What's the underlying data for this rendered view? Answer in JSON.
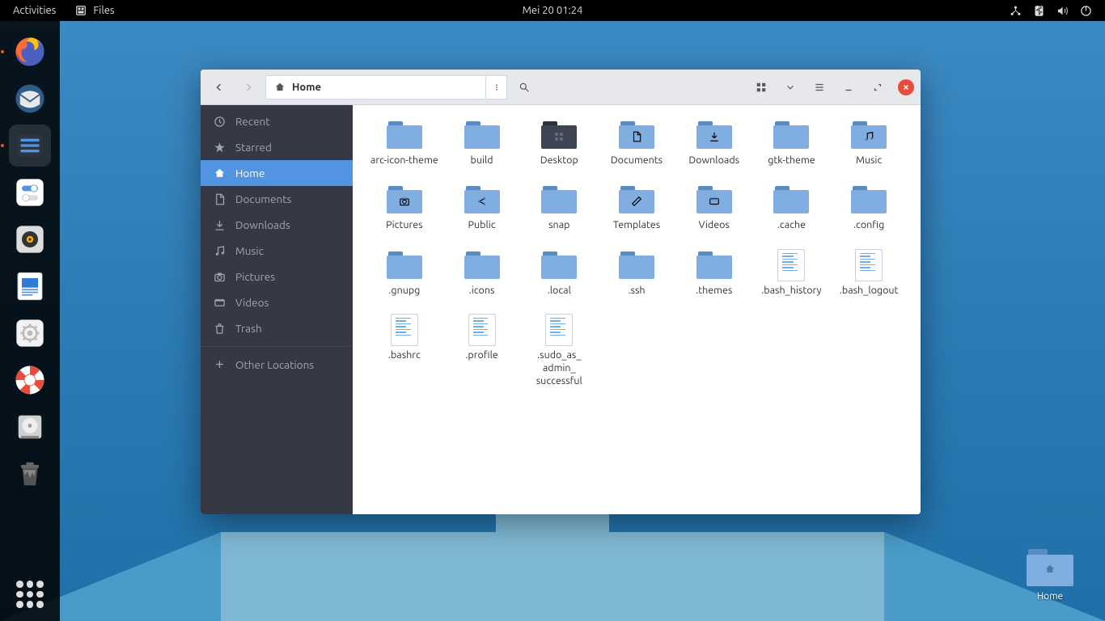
{
  "topbar": {
    "activities": "Activities",
    "app_name": "Files",
    "datetime": "Mei 20  01:24"
  },
  "desktop": {
    "home_label": "Home"
  },
  "window": {
    "path_label": "Home"
  },
  "sidebar": {
    "items": [
      {
        "id": "recent",
        "label": "Recent",
        "icon": "clock"
      },
      {
        "id": "starred",
        "label": "Starred",
        "icon": "star"
      },
      {
        "id": "home",
        "label": "Home",
        "icon": "home",
        "active": true
      },
      {
        "id": "documents",
        "label": "Documents",
        "icon": "doc"
      },
      {
        "id": "downloads",
        "label": "Downloads",
        "icon": "download"
      },
      {
        "id": "music",
        "label": "Music",
        "icon": "music"
      },
      {
        "id": "pictures",
        "label": "Pictures",
        "icon": "camera"
      },
      {
        "id": "videos",
        "label": "Videos",
        "icon": "video"
      },
      {
        "id": "trash",
        "label": "Trash",
        "icon": "trash"
      },
      {
        "id": "other",
        "label": "Other Locations",
        "icon": "plus",
        "sep": true
      }
    ]
  },
  "files": [
    {
      "name": "arc-icon-theme",
      "type": "folder"
    },
    {
      "name": "build",
      "type": "folder"
    },
    {
      "name": "Desktop",
      "type": "folder-dark",
      "inner": "grid"
    },
    {
      "name": "Documents",
      "type": "folder",
      "inner": "doc"
    },
    {
      "name": "Downloads",
      "type": "folder",
      "inner": "download"
    },
    {
      "name": "gtk-theme",
      "type": "folder"
    },
    {
      "name": "Music",
      "type": "folder",
      "inner": "music"
    },
    {
      "name": "Pictures",
      "type": "folder",
      "inner": "camera"
    },
    {
      "name": "Public",
      "type": "folder",
      "inner": "share"
    },
    {
      "name": "snap",
      "type": "folder"
    },
    {
      "name": "Templates",
      "type": "folder",
      "inner": "ruler"
    },
    {
      "name": "Videos",
      "type": "folder",
      "inner": "video"
    },
    {
      "name": ".cache",
      "type": "folder"
    },
    {
      "name": ".config",
      "type": "folder"
    },
    {
      "name": ".gnupg",
      "type": "folder"
    },
    {
      "name": ".icons",
      "type": "folder"
    },
    {
      "name": ".local",
      "type": "folder"
    },
    {
      "name": ".ssh",
      "type": "folder"
    },
    {
      "name": ".themes",
      "type": "folder"
    },
    {
      "name": ".bash_history",
      "type": "text"
    },
    {
      "name": ".bash_logout",
      "type": "text"
    },
    {
      "name": ".bashrc",
      "type": "text"
    },
    {
      "name": ".profile",
      "type": "text"
    },
    {
      "name": ".sudo_as_admin_successful",
      "type": "text"
    }
  ]
}
